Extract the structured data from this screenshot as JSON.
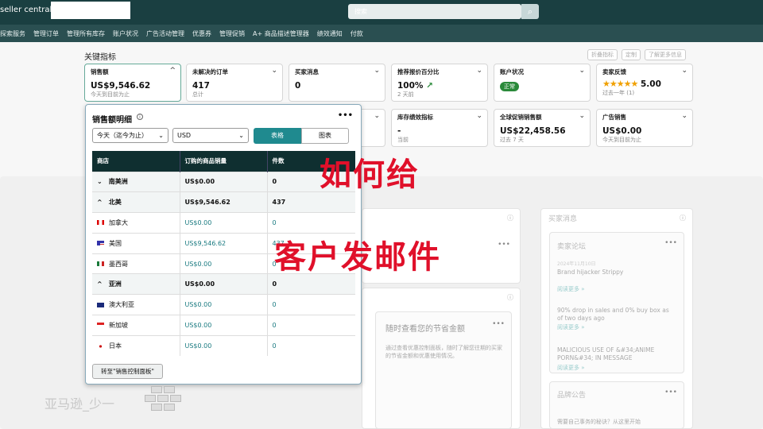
{
  "header": {
    "logo": "seller central",
    "search_placeholder": "搜索"
  },
  "nav": [
    "探索服务",
    "管理订单",
    "管理所有库存",
    "账户状况",
    "广告活动管理",
    "优惠券",
    "管理促销",
    "A+ 商品描述管理器",
    "绩效通知",
    "付款"
  ],
  "section_title": "关键指标",
  "tools": [
    "折叠指标",
    "定制",
    "了解更多信息"
  ],
  "cards": [
    {
      "title": "销售额",
      "value": "US$9,546.62",
      "sub": "今天到目前为止"
    },
    {
      "title": "未解决的订单",
      "value": "417",
      "sub": "总计"
    },
    {
      "title": "买家消息",
      "value": "0",
      "sub": ""
    },
    {
      "title": "推荐报价百分比",
      "value": "100%",
      "sub": "2 天前"
    },
    {
      "title": "账户状况",
      "badge": "正常"
    },
    {
      "title": "卖家反馈",
      "stars": "★★★★★",
      "value": "5.00",
      "sub": "过去一年 (1)"
    },
    {
      "title": "库存绩效指标",
      "value": "-",
      "sub": "当前"
    },
    {
      "title": "全球促销销售额",
      "value": "US$22,458.56",
      "sub": "过去 7 天"
    },
    {
      "title": "广告销售",
      "value": "US$0.00",
      "sub": "今天到目前为止"
    }
  ],
  "background": {
    "buyer_messages": "买家消息",
    "seller_forum": "卖家论坛",
    "date1": "2024年11月10日",
    "post1": "Brand hijacker Strippy",
    "read_more": "阅读更多 »",
    "post2": "90% drop in sales and 0% buy box as of two days ago",
    "post3": "MALICIOUS USE OF &#34;ANIME PORN&#34; IN MESSAGE",
    "brand_ann": "品牌公告",
    "brand_post": "需要自己事务的秘诀？从这里开始",
    "holiday_title": "随时查看您的节省金额",
    "holiday_text": "通过查看优惠控制面板，随时了解您往期的买家的节省金额和优惠使用情况。"
  },
  "popup": {
    "title": "销售额明细",
    "period": "今天（迄今为止）",
    "currency": "USD",
    "table_btn": "表格",
    "chart_btn": "图表",
    "columns": [
      "商店",
      "订购的商品销量",
      "件数"
    ],
    "rows": [
      {
        "name": "南美洲",
        "sales": "US$0.00",
        "units": "0",
        "region": true,
        "caret": "⌄"
      },
      {
        "name": "北美",
        "sales": "US$9,546.62",
        "units": "437",
        "region": true,
        "caret": "^"
      },
      {
        "name": "加拿大",
        "sales": "US$0.00",
        "units": "0",
        "flag": "ca"
      },
      {
        "name": "美国",
        "sales": "US$9,546.62",
        "units": "437",
        "flag": "us"
      },
      {
        "name": "墨西哥",
        "sales": "US$0.00",
        "units": "0",
        "flag": "mx"
      },
      {
        "name": "亚洲",
        "sales": "US$0.00",
        "units": "0",
        "region": true,
        "caret": "^"
      },
      {
        "name": "澳大利亚",
        "sales": "US$0.00",
        "units": "0",
        "flag": "au"
      },
      {
        "name": "新加坡",
        "sales": "US$0.00",
        "units": "0",
        "flag": "sg"
      },
      {
        "name": "日本",
        "sales": "US$0.00",
        "units": "0",
        "flag": "jp"
      }
    ],
    "goto_btn": "转至\"销售控制面板\""
  },
  "overlay": {
    "line1": "如何给",
    "line2": "客户发邮件"
  },
  "watermark": "亚马逊_少一"
}
